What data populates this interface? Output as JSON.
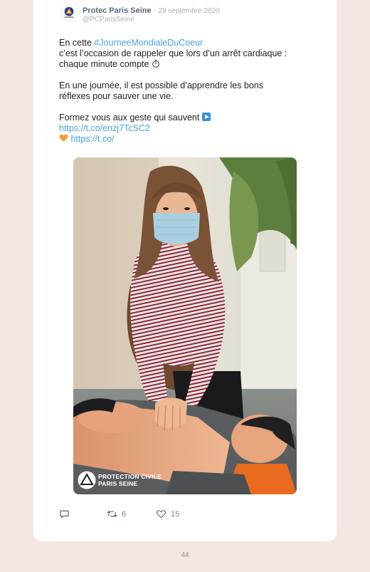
{
  "tweet": {
    "author": "Protec Paris Seine",
    "separator": " · ",
    "date": "29 septembre 2020",
    "handle": "@PCParisSeine",
    "p1_pre": "En cette ",
    "hashtag": "#JourneeMondialeDuCoeur",
    "p1_line2": "c’est l’occasion de rappeler que lors d’un arrêt cardiaque :",
    "p1_line3": "chaque minute compte",
    "p2_line1": "En une journée, il est possible d’apprendre les bons",
    "p2_line2": "réflexes pour sauver une vie.",
    "p3_line1": "Formez vous aux geste qui sauvent",
    "link1": "https://t.co/enzj7TcSC2",
    "link2": "https://t.co/"
  },
  "photo": {
    "badge_line1": "PROTECTION CIVILE",
    "badge_line2": "PARIS SEINE"
  },
  "actions": {
    "reply_icon": "reply-icon",
    "retweet_icon": "retweet-icon",
    "like_icon": "heart-icon",
    "retweets": "6",
    "likes": "15"
  },
  "page": {
    "number": "44"
  },
  "colors": {
    "background": "#f6e6e3",
    "card": "#ffffff",
    "link": "#4ba3e3",
    "author": "#58677a",
    "muted": "#a6b0bb",
    "brand_orange": "#f07c1c",
    "brand_blue": "#1d3d8f"
  }
}
